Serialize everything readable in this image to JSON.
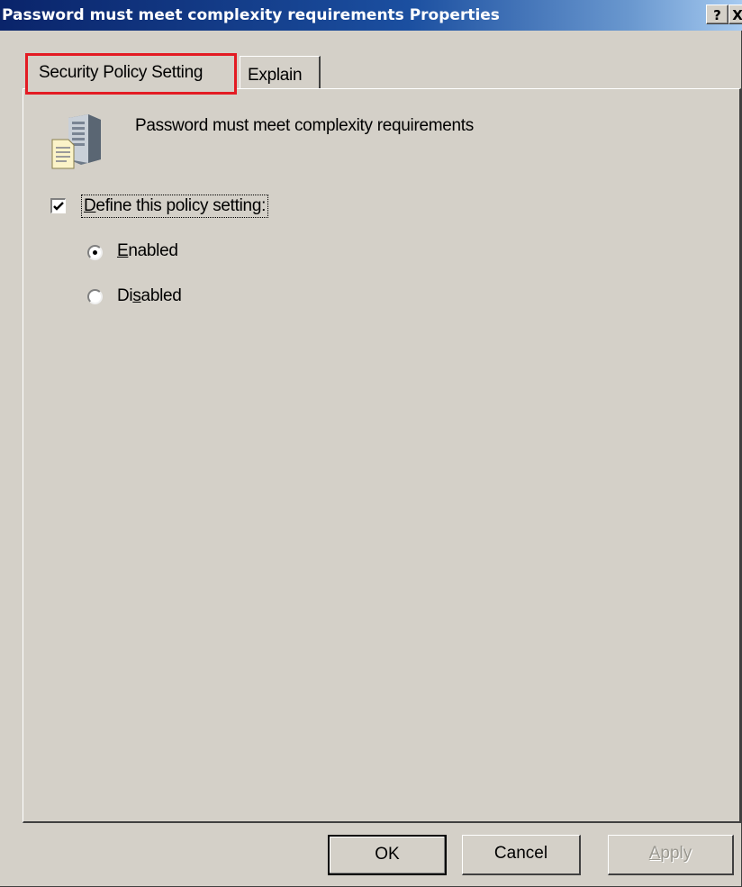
{
  "window": {
    "title": "Password must meet complexity requirements Properties",
    "help_button": "?",
    "close_button": "X"
  },
  "tabs": [
    {
      "label": "Security Policy Setting",
      "active": true,
      "highlighted": true
    },
    {
      "label": "Explain",
      "active": false
    }
  ],
  "policy": {
    "name": "Password must meet complexity requirements",
    "icon": "server-document-icon"
  },
  "define_setting": {
    "label": "Define this policy setting",
    "accel_label": "D",
    "checked": true
  },
  "options": {
    "enabled": {
      "label_accel": "E",
      "label_rest": "nabled",
      "selected": true
    },
    "disabled": {
      "label_pre": "Di",
      "label_accel": "s",
      "label_rest": "abled",
      "selected": false
    }
  },
  "buttons": {
    "ok": "OK",
    "cancel": "Cancel",
    "apply_accel": "A",
    "apply_rest": "pply",
    "apply_enabled": false
  },
  "colors": {
    "highlight": "#e31b23",
    "titlebar_start": "#0a246a",
    "titlebar_end": "#a6caf0",
    "dialog_bg": "#d4d0c8"
  }
}
